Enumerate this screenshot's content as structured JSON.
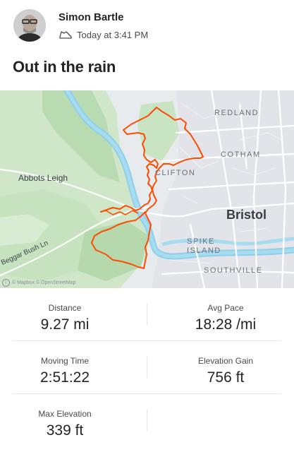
{
  "athlete": {
    "name": "Simon Bartle",
    "timestamp": "Today at 3:41 PM"
  },
  "activity": {
    "title": "Out in the rain"
  },
  "map": {
    "labels": {
      "redland": "REDLAND",
      "cotham": "COTHAM",
      "clifton": "CLIFTON",
      "abbots_leigh": "Abbots Leigh",
      "bristol": "Bristol",
      "spike_island": "SPIKE ISLAND",
      "southville": "SOUTHVILLE",
      "beggar_bush_ln": "Beggar Bush Ln"
    },
    "attribution": "© Mapbox © OpenStreetMap",
    "route_color": "#fc4c02"
  },
  "stats": {
    "distance": {
      "label": "Distance",
      "value": "9.27 mi"
    },
    "avg_pace": {
      "label": "Avg Pace",
      "value": "18:28 /mi"
    },
    "moving_time": {
      "label": "Moving Time",
      "value": "2:51:22"
    },
    "elevation_gain": {
      "label": "Elevation Gain",
      "value": "756 ft"
    },
    "max_elevation": {
      "label": "Max Elevation",
      "value": "339 ft"
    }
  }
}
